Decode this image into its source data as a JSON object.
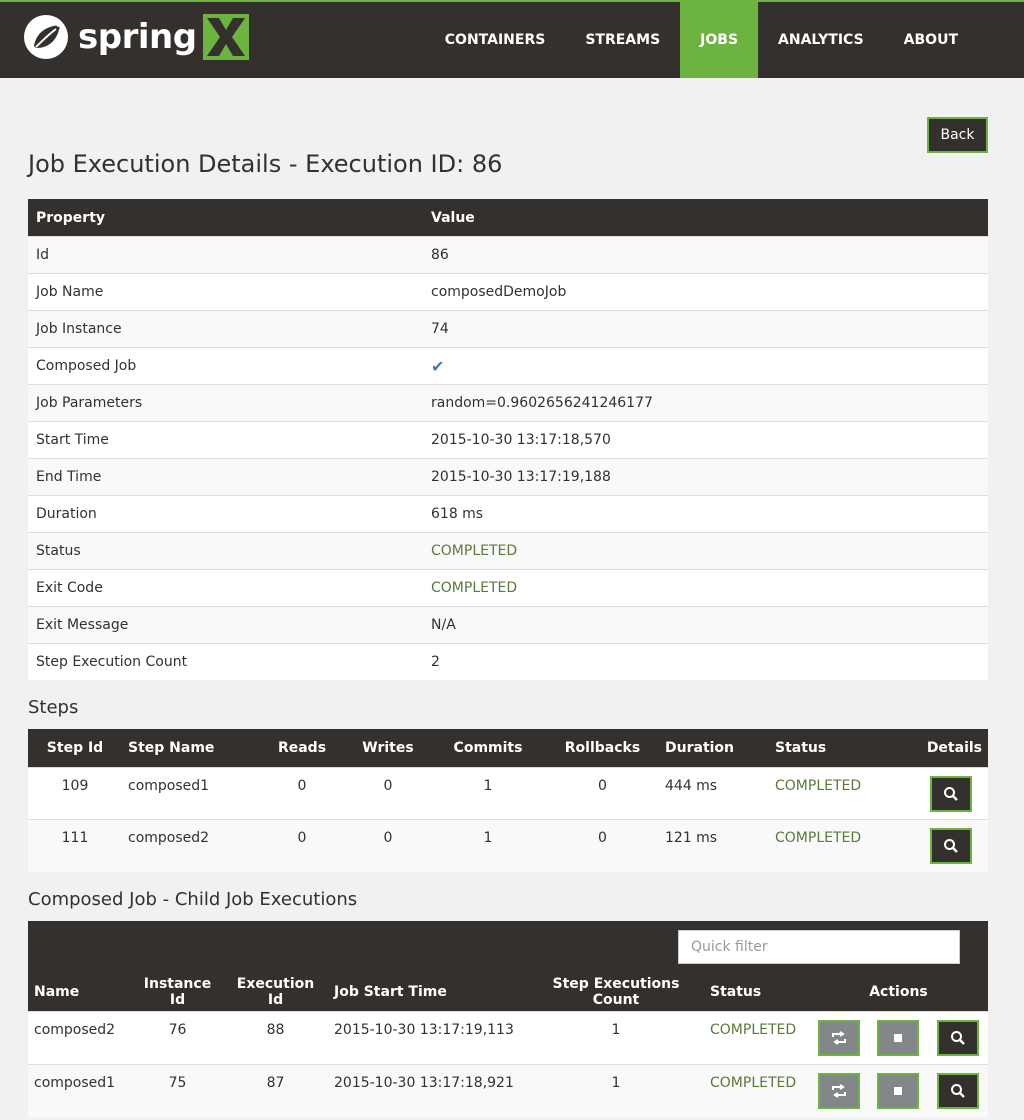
{
  "brand": {
    "name": "spring",
    "accent": "#6db33f",
    "dark": "#34302d"
  },
  "nav": [
    {
      "label": "CONTAINERS",
      "active": false
    },
    {
      "label": "STREAMS",
      "active": false
    },
    {
      "label": "JOBS",
      "active": true
    },
    {
      "label": "ANALYTICS",
      "active": false
    },
    {
      "label": "ABOUT",
      "active": false
    }
  ],
  "back_label": "Back",
  "page_title": "Job Execution Details - Execution ID: 86",
  "details": {
    "headers": [
      "Property",
      "Value"
    ],
    "rows": [
      {
        "property": "Id",
        "value": "86"
      },
      {
        "property": "Job Name",
        "value": "composedDemoJob"
      },
      {
        "property": "Job Instance",
        "value": "74"
      },
      {
        "property": "Composed Job",
        "value": "✔"
      },
      {
        "property": "Job Parameters",
        "value": "random=0.9602656241246177"
      },
      {
        "property": "Start Time",
        "value": "2015-10-30 13:17:18,570"
      },
      {
        "property": "End Time",
        "value": "2015-10-30 13:17:19,188"
      },
      {
        "property": "Duration",
        "value": "618 ms"
      },
      {
        "property": "Status",
        "value": "COMPLETED"
      },
      {
        "property": "Exit Code",
        "value": "COMPLETED"
      },
      {
        "property": "Exit Message",
        "value": "N/A"
      },
      {
        "property": "Step Execution Count",
        "value": "2"
      }
    ]
  },
  "steps": {
    "title": "Steps",
    "headers": [
      "Step Id",
      "Step Name",
      "Reads",
      "Writes",
      "Commits",
      "Rollbacks",
      "Duration",
      "Status",
      "Details"
    ],
    "rows": [
      {
        "id": "109",
        "name": "composed1",
        "reads": "0",
        "writes": "0",
        "commits": "1",
        "rollbacks": "0",
        "duration": "444 ms",
        "status": "COMPLETED"
      },
      {
        "id": "111",
        "name": "composed2",
        "reads": "0",
        "writes": "0",
        "commits": "1",
        "rollbacks": "0",
        "duration": "121 ms",
        "status": "COMPLETED"
      }
    ]
  },
  "composed": {
    "title": "Composed Job - Child Job Executions",
    "filter_placeholder": "Quick filter",
    "headers": [
      "Name",
      "Instance Id",
      "Execution Id",
      "Job Start Time",
      "Step Executions Count",
      "Status",
      "Actions"
    ],
    "rows": [
      {
        "name": "composed2",
        "instance_id": "76",
        "execution_id": "88",
        "start_time": "2015-10-30 13:17:19,113",
        "step_count": "1",
        "status": "COMPLETED"
      },
      {
        "name": "composed1",
        "instance_id": "75",
        "execution_id": "87",
        "start_time": "2015-10-30 13:17:18,921",
        "step_count": "1",
        "status": "COMPLETED"
      }
    ]
  },
  "icons": {
    "detail": "search-icon",
    "restart": "restart-icon",
    "stop": "stop-icon",
    "check": "check-icon"
  }
}
